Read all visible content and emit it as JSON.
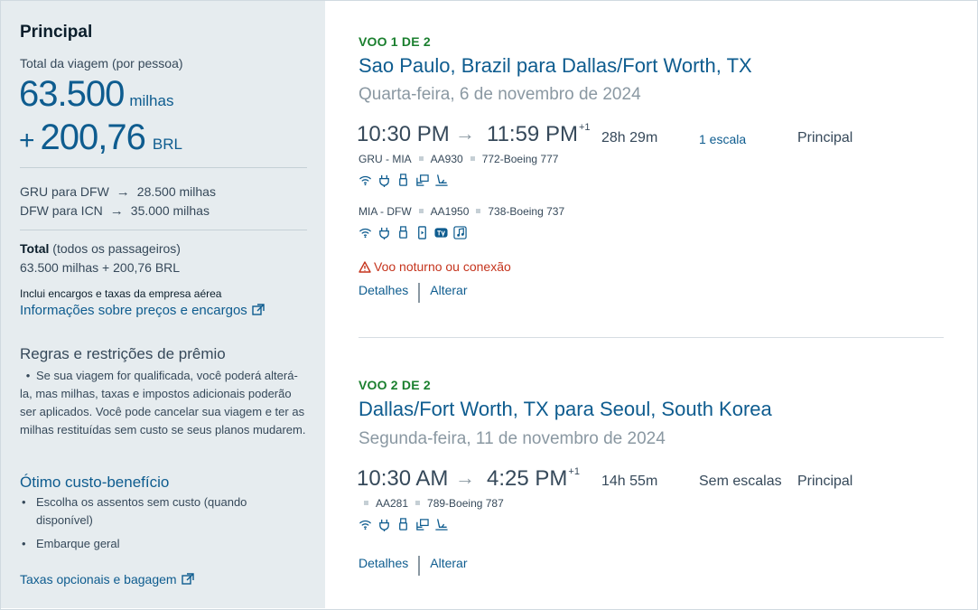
{
  "sidebar": {
    "title": "Principal",
    "subtitle": "Total da viagem (por pessoa)",
    "miles_amount": "63.500",
    "miles_unit": "milhas",
    "cash_plus": "+",
    "cash_amount": "200,76",
    "cash_unit": "BRL",
    "legs": [
      {
        "from": "GRU para DFW",
        "miles": "28.500 milhas"
      },
      {
        "from": "DFW para ICN",
        "miles": "35.000 milhas"
      }
    ],
    "total_label": "Total",
    "total_suffix": "(todos os passageiros)",
    "total_value": "63.500 milhas + 200,76 BRL",
    "fees_note": "Inclui encargos e taxas da empresa aérea",
    "fees_link": "Informações sobre preços e encargos",
    "rules_title": "Regras e restrições de prêmio",
    "rules_text": "Se sua viagem for qualificada, você poderá alterá-la, mas milhas, taxas e impostos adicionais poderão ser aplicados. Você pode cancelar sua viagem e ter as milhas restituídas sem custo se seus planos mudarem.",
    "value_title": "Ótimo custo-benefício",
    "value_items": [
      {
        "line1": "Escolha os assentos sem custo (quando",
        "line2": "disponível)"
      },
      {
        "line1": "Embarque geral",
        "line2": ""
      }
    ],
    "bag_link": "Taxas opcionais e bagagem"
  },
  "flights": [
    {
      "label": "VOO 1 DE 2",
      "route": "Sao Paulo, Brazil para Dallas/Fort Worth, TX",
      "date": "Quarta-feira, 6 de novembro de 2024",
      "depart": "10:30 PM",
      "arrive": "11:59 PM",
      "day_offset": "+1",
      "duration": "28h 29m",
      "stops": "1 escala",
      "cabin": "Principal",
      "segments": [
        {
          "route": "GRU - MIA",
          "flight": "AA930",
          "aircraft": "772-Boeing 777",
          "amenities": [
            "wifi-icon",
            "power-icon",
            "usb-icon",
            "seat-video-icon",
            "lie-flat-seat-icon"
          ]
        },
        {
          "route": "MIA - DFW",
          "flight": "AA1950",
          "aircraft": "738-Boeing 737",
          "amenities": [
            "wifi-icon",
            "power-icon",
            "usb-icon",
            "device-streaming-icon",
            "tv-icon",
            "music-icon"
          ]
        }
      ],
      "warning": "Voo noturno ou conexão",
      "details_link": "Detalhes",
      "change_link": "Alterar"
    },
    {
      "label": "VOO 2 DE 2",
      "route": "Dallas/Fort Worth, TX para Seoul, South Korea",
      "date": "Segunda-feira, 11 de novembro de 2024",
      "depart": "10:30 AM",
      "arrive": "4:25 PM",
      "day_offset": "+1",
      "duration": "14h 55m",
      "stops": "Sem escalas",
      "cabin": "Principal",
      "segments": [
        {
          "route": "",
          "flight": "AA281",
          "aircraft": "789-Boeing 787",
          "amenities": [
            "wifi-icon",
            "power-icon",
            "usb-icon",
            "seat-video-icon",
            "lie-flat-seat-icon"
          ]
        }
      ],
      "details_link": "Detalhes",
      "change_link": "Alterar"
    }
  ],
  "colors": {
    "accent": "#0e5c8f",
    "sidebar_bg": "#e6ecef",
    "success": "#1a7f2e",
    "warning": "#c5341d"
  }
}
